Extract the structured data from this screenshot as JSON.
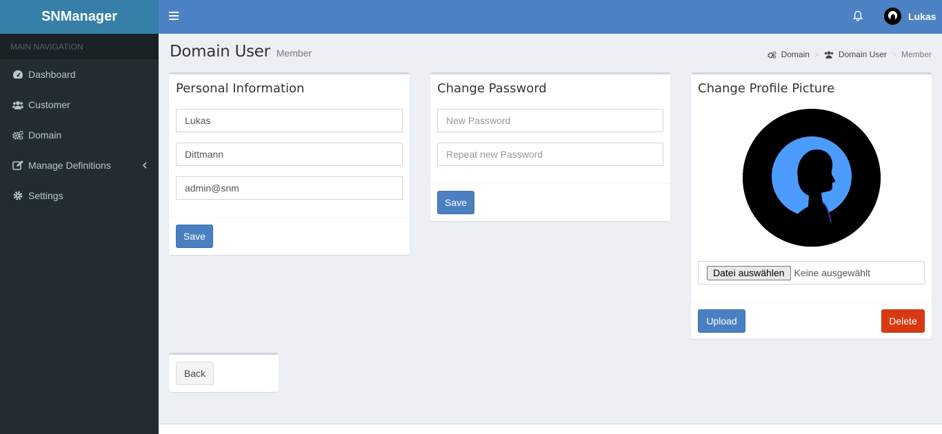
{
  "app": {
    "logo_prefix": "SN",
    "logo_main": "Manager"
  },
  "sidebar": {
    "header": "MAIN NAVIGATION",
    "items": [
      {
        "label": "Dashboard",
        "icon": "dashboard-icon"
      },
      {
        "label": "Customer",
        "icon": "users-icon"
      },
      {
        "label": "Domain",
        "icon": "cogs-icon"
      },
      {
        "label": "Manage Definitions",
        "icon": "edit-icon"
      },
      {
        "label": "Settings",
        "icon": "gear-icon"
      }
    ]
  },
  "topbar": {
    "username": "Lukas"
  },
  "page": {
    "title": "Domain User",
    "subtitle": "Member",
    "breadcrumb": [
      "Domain",
      "Domain User",
      "Member"
    ]
  },
  "personal": {
    "title": "Personal Information",
    "first_name": "Lukas",
    "last_name": "Dittmann",
    "email": "admin@snm",
    "save_label": "Save"
  },
  "password": {
    "title": "Change Password",
    "new_placeholder": "New Password",
    "repeat_placeholder": "Repeat new Password",
    "save_label": "Save"
  },
  "picture": {
    "title": "Change Profile Picture",
    "file_button": "Datei auswählen",
    "file_status": "Keine ausgewählt",
    "upload_label": "Upload",
    "delete_label": "Delete"
  },
  "back": {
    "label": "Back"
  },
  "colors": {
    "header": "#4c82c4",
    "sidebar": "#222d32",
    "primary": "#4a7fc2",
    "danger": "#d73a12",
    "avatar_bg": "#4c9cff"
  }
}
